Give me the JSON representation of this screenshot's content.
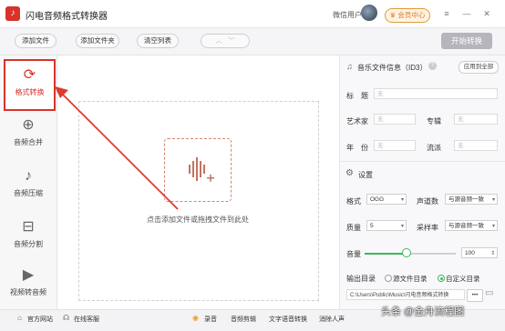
{
  "app": {
    "title": "闪电音频格式转换器",
    "logo_icon": "music-note-icon"
  },
  "titlebar": {
    "user_name": "微信用户",
    "vip_label": "会员中心",
    "accent": "#d9322b"
  },
  "toolbar": {
    "add_file": "添加文件",
    "add_folder": "添加文件夹",
    "clear_list": "清空列表",
    "start": "开始转换"
  },
  "sidebar": {
    "items": [
      {
        "label": "格式转换",
        "icon": "refresh-icon",
        "active": true
      },
      {
        "label": "音频合并",
        "icon": "merge-icon"
      },
      {
        "label": "音频压缩",
        "icon": "compress-icon"
      },
      {
        "label": "音频分割",
        "icon": "split-icon"
      },
      {
        "label": "视频转音频",
        "icon": "video-icon"
      }
    ]
  },
  "main": {
    "drop_text": "点击添加文件或拖拽文件到此处"
  },
  "info": {
    "title": "音乐文件信息（ID3）",
    "apply_all": "应用到全部",
    "field_title": "标　题",
    "field_artist": "艺术家",
    "field_album": "专辑",
    "field_year": "年　份",
    "field_genre": "流派",
    "placeholder": "无"
  },
  "settings": {
    "title": "设置",
    "format_label": "格式",
    "format_value": "OGG",
    "channel_label": "声道数",
    "channel_value": "与源音频一致",
    "quality_label": "质量",
    "quality_value": "5",
    "samplerate_label": "采样率",
    "samplerate_value": "与源音频一致",
    "volume_label": "音量",
    "volume_value": "100",
    "volume_level": 0.45,
    "output_label": "输出目录",
    "output_source": "源文件目录",
    "output_custom": "自定义目录",
    "output_path": "C:\\Users\\Public\\Music\\闪电音频格式转换",
    "more": "•••"
  },
  "bottom": {
    "website": "官方网站",
    "service": "在线客服",
    "record": "录音",
    "cut": "音频剪辑",
    "tts": "文字语音转换",
    "vocal": "消除人声"
  },
  "watermark": "头条 @金舟流程图"
}
